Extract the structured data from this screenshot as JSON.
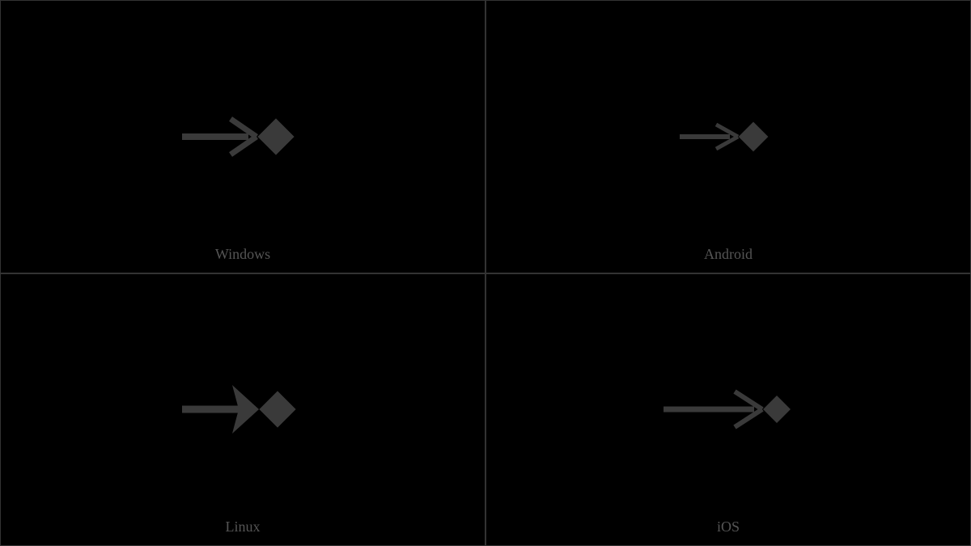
{
  "cells": [
    {
      "label": "Windows",
      "class": "windows"
    },
    {
      "label": "Android",
      "class": "android"
    },
    {
      "label": "Linux",
      "class": "linux"
    },
    {
      "label": "iOS",
      "class": "ios"
    }
  ],
  "glyph_color": "#3a3a3a"
}
